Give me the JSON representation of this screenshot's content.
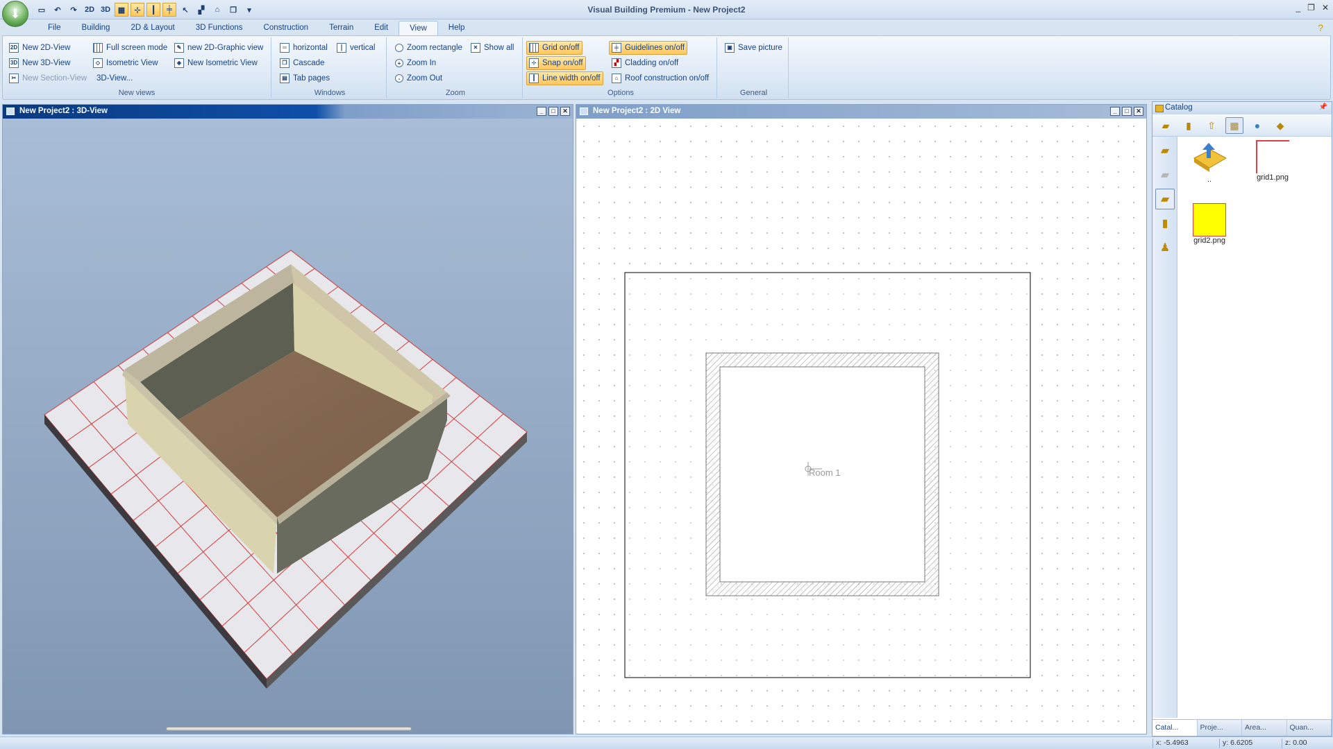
{
  "app": {
    "title": "Visual Building Premium - New Project2"
  },
  "window_controls": {
    "minimize": "_",
    "restore": "❐",
    "close": "✕"
  },
  "quick_access": {
    "btn_2d": "2D",
    "btn_3d": "3D"
  },
  "menu": {
    "tabs": [
      "File",
      "Building",
      "2D & Layout",
      "3D Functions",
      "Construction",
      "Terrain",
      "Edit",
      "View",
      "Help"
    ],
    "active": "View"
  },
  "ribbon": {
    "new_views": {
      "caption": "New views",
      "new_2d": "New 2D-View",
      "new_3d": "New 3D-View",
      "new_section": "New Section-View",
      "full_screen": "Full screen mode",
      "isometric": "Isometric View",
      "view3d": "3D-View...",
      "new_2d_graphic": "new 2D-Graphic view",
      "new_isometric": "New Isometric View"
    },
    "windows": {
      "caption": "Windows",
      "horizontal": "horizontal",
      "vertical": "vertical",
      "cascade": "Cascade",
      "tab_pages": "Tab pages"
    },
    "zoom": {
      "caption": "Zoom",
      "zoom_rect": "Zoom rectangle",
      "show_all": "Show all",
      "zoom_in": "Zoom In",
      "zoom_out": "Zoom Out"
    },
    "options": {
      "caption": "Options",
      "grid": "Grid on/off",
      "snap": "Snap on/off",
      "line_width": "Line width on/off",
      "guidelines": "Guidelines on/off",
      "cladding": "Cladding on/off",
      "roof": "Roof construction on/off"
    },
    "general": {
      "caption": "General",
      "save_picture": "Save picture"
    }
  },
  "view3d": {
    "title": "New Project2 : 3D-View"
  },
  "view2d": {
    "title": "New Project2 : 2D View",
    "room_label": "Room 1"
  },
  "catalog": {
    "title": "Catalog",
    "items": [
      {
        "label": ".."
      },
      {
        "label": "grid1.png"
      },
      {
        "label": "grid2.png"
      }
    ],
    "tabs": [
      "Catal...",
      "Proje...",
      "Area...",
      "Quan..."
    ]
  },
  "status": {
    "x": "x: -5.4963",
    "y": "y: 6.6205",
    "z": "z: 0.00"
  },
  "colors": {
    "active_title": "#0b3f86",
    "option_on": "#ffc65e",
    "view_bg_top": "#a9bdd6",
    "grid_red": "#d23a3a",
    "yellow_swatch": "#ffff00"
  }
}
